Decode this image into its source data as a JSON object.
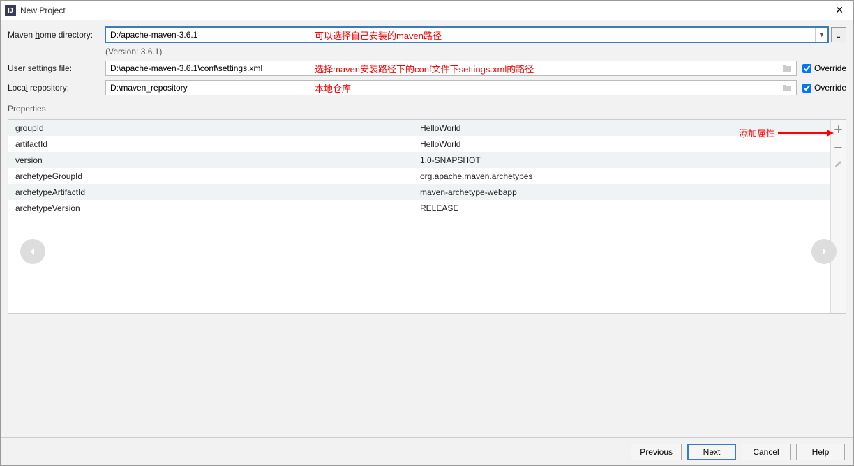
{
  "window": {
    "title": "New Project"
  },
  "form": {
    "mavenHome": {
      "label_pre": "Maven ",
      "label_u": "h",
      "label_post": "ome directory:",
      "value": "D:/apache-maven-3.6.1"
    },
    "versionLine": "(Version: 3.6.1)",
    "settings": {
      "label_pre": "",
      "label_u": "U",
      "label_post": "ser settings file:",
      "value": "D:\\apache-maven-3.6.1\\conf\\settings.xml"
    },
    "repo": {
      "label_pre": "Loca",
      "label_u": "l",
      "label_post": " repository:",
      "value": "D:\\maven_repository"
    },
    "override": "Override"
  },
  "annotations": {
    "mavenHome": "可以选择自己安装的maven路径",
    "settings": "选择maven安装路径下的conf文件下settings.xml的路径",
    "repo": "本地仓库",
    "add": "添加属性"
  },
  "propertiesLabel": "Properties",
  "properties": [
    {
      "key": "groupId",
      "value": "HelloWorld"
    },
    {
      "key": "artifactId",
      "value": "HelloWorld"
    },
    {
      "key": "version",
      "value": "1.0-SNAPSHOT"
    },
    {
      "key": "archetypeGroupId",
      "value": "org.apache.maven.archetypes"
    },
    {
      "key": "archetypeArtifactId",
      "value": "maven-archetype-webapp"
    },
    {
      "key": "archetypeVersion",
      "value": "RELEASE"
    }
  ],
  "buttons": {
    "previous_pre": "",
    "previous_u": "P",
    "previous_post": "revious",
    "next_pre": "",
    "next_u": "N",
    "next_post": "ext",
    "cancel": "Cancel",
    "help": "Help"
  }
}
